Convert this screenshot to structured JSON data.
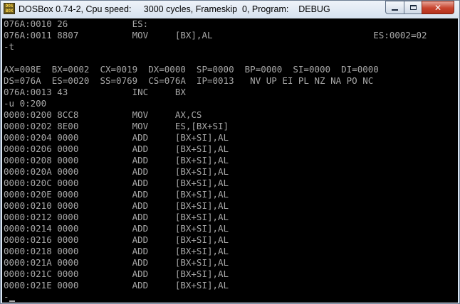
{
  "window": {
    "icon_text": "DOS BOX",
    "title": "DOSBox 0.74-2, Cpu speed:     3000 cycles, Frameskip  0, Program:    DEBUG",
    "controls": {
      "minimize_icon": "minimize-icon",
      "maximize_icon": "maximize-icon",
      "close_glyph": "✕"
    }
  },
  "terminal": {
    "lines": [
      "076A:0010 26            ES:",
      "076A:0011 8807          MOV     [BX],AL                              ES:0002=02",
      "-t",
      "",
      "AX=008E  BX=0002  CX=0019  DX=0000  SP=0000  BP=0000  SI=0000  DI=0000",
      "DS=076A  ES=0020  SS=0769  CS=076A  IP=0013   NV UP EI PL NZ NA PO NC",
      "076A:0013 43            INC     BX",
      "-u 0:200",
      "0000:0200 8CC8          MOV     AX,CS",
      "0000:0202 8E00          MOV     ES,[BX+SI]",
      "0000:0204 0000          ADD     [BX+SI],AL",
      "0000:0206 0000          ADD     [BX+SI],AL",
      "0000:0208 0000          ADD     [BX+SI],AL",
      "0000:020A 0000          ADD     [BX+SI],AL",
      "0000:020C 0000          ADD     [BX+SI],AL",
      "0000:020E 0000          ADD     [BX+SI],AL",
      "0000:0210 0000          ADD     [BX+SI],AL",
      "0000:0212 0000          ADD     [BX+SI],AL",
      "0000:0214 0000          ADD     [BX+SI],AL",
      "0000:0216 0000          ADD     [BX+SI],AL",
      "0000:0218 0000          ADD     [BX+SI],AL",
      "0000:021A 0000          ADD     [BX+SI],AL",
      "0000:021C 0000          ADD     [BX+SI],AL",
      "0000:021E 0000          ADD     [BX+SI],AL",
      "-"
    ],
    "text_color": "#a8a8a8",
    "background_color": "#000000"
  }
}
